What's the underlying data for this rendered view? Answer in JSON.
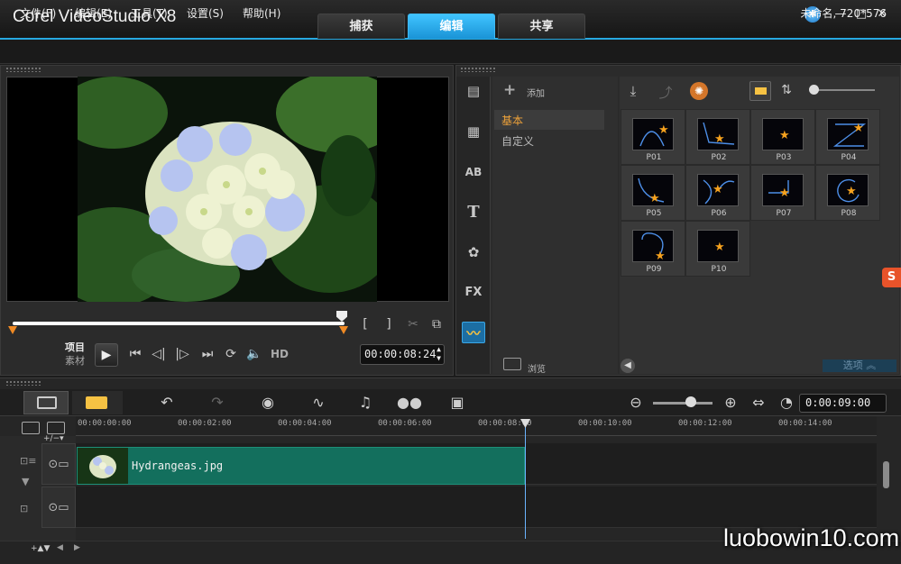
{
  "window": {
    "title": "Corel VideoStudio X8",
    "tabs": [
      "捕获",
      "编辑",
      "共享"
    ],
    "active_tab": "编辑",
    "accent_color": "#27a9e1"
  },
  "menu": {
    "items": [
      "文件(F)",
      "编辑(E)",
      "工具(T)",
      "设置(S)",
      "帮助(H)"
    ],
    "project_info": "未命名, 720*576"
  },
  "preview": {
    "mode_project": "项目",
    "mode_clip": "素材",
    "hd_label": "HD",
    "timecode": "00:00:08:24"
  },
  "library": {
    "add_label": "添加",
    "categories": [
      "基本",
      "自定义"
    ],
    "browse_label": "浏览",
    "options_label": "选项",
    "thumbnails": [
      "P01",
      "P02",
      "P03",
      "P04",
      "P05",
      "P06",
      "P07",
      "P08",
      "P09",
      "P10"
    ],
    "sidebar_icons": [
      "media-icon",
      "instant-project-icon",
      "transition-icon",
      "title-icon",
      "graphic-icon",
      "filter-icon",
      "path-icon"
    ]
  },
  "timeline": {
    "total_time": "0:00:09:00",
    "ruler_labels": [
      "00:00:00:00",
      "00:00:02:00",
      "00:00:04:00",
      "00:00:06:00",
      "00:00:08:00",
      "00:00:10:00",
      "00:00:12:00",
      "00:00:14:00"
    ],
    "clip_name": "Hydrangeas.jpg"
  },
  "watermark": "luobowin10.com"
}
